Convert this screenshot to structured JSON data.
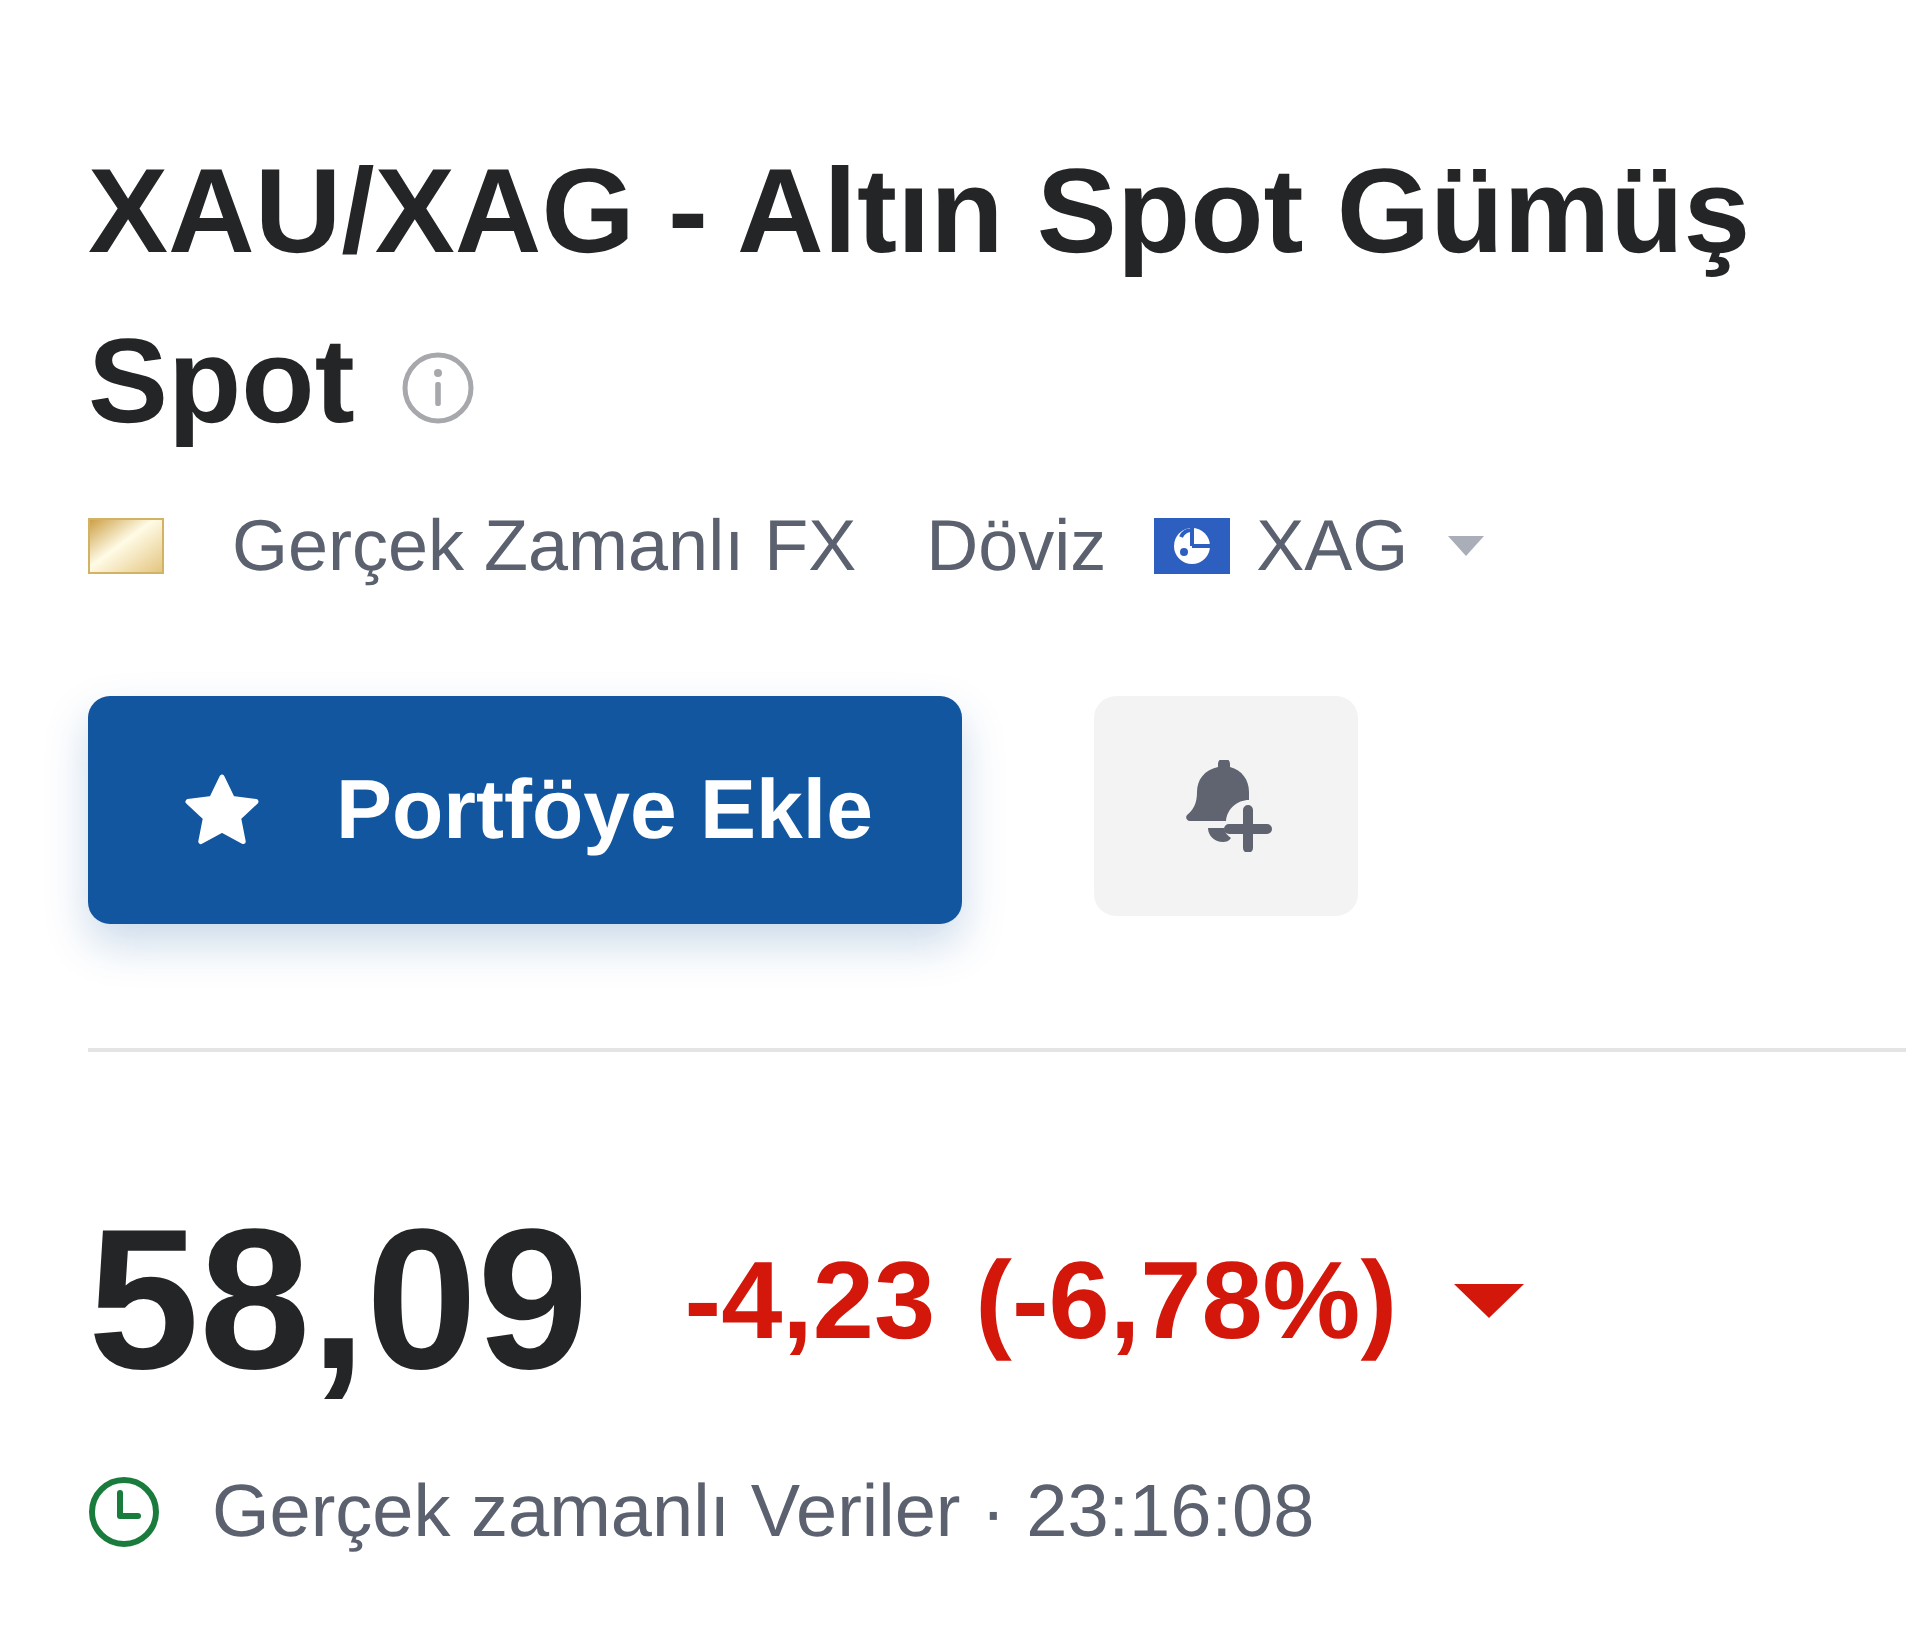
{
  "title_lines": [
    "XAU/XAG - Altın Spot Gümüş",
    "Spot"
  ],
  "meta": {
    "source": "Gerçek Zamanlı FX",
    "category": "Döviz",
    "currency": "XAG"
  },
  "actions": {
    "portfolio_button": "Portföye Ekle"
  },
  "quote": {
    "price": "58,09",
    "change": "-4,23",
    "change_percent": "(-6,78%)",
    "negative": true
  },
  "status": {
    "text": "Gerçek zamanlı Veriler · 23:16:08"
  }
}
